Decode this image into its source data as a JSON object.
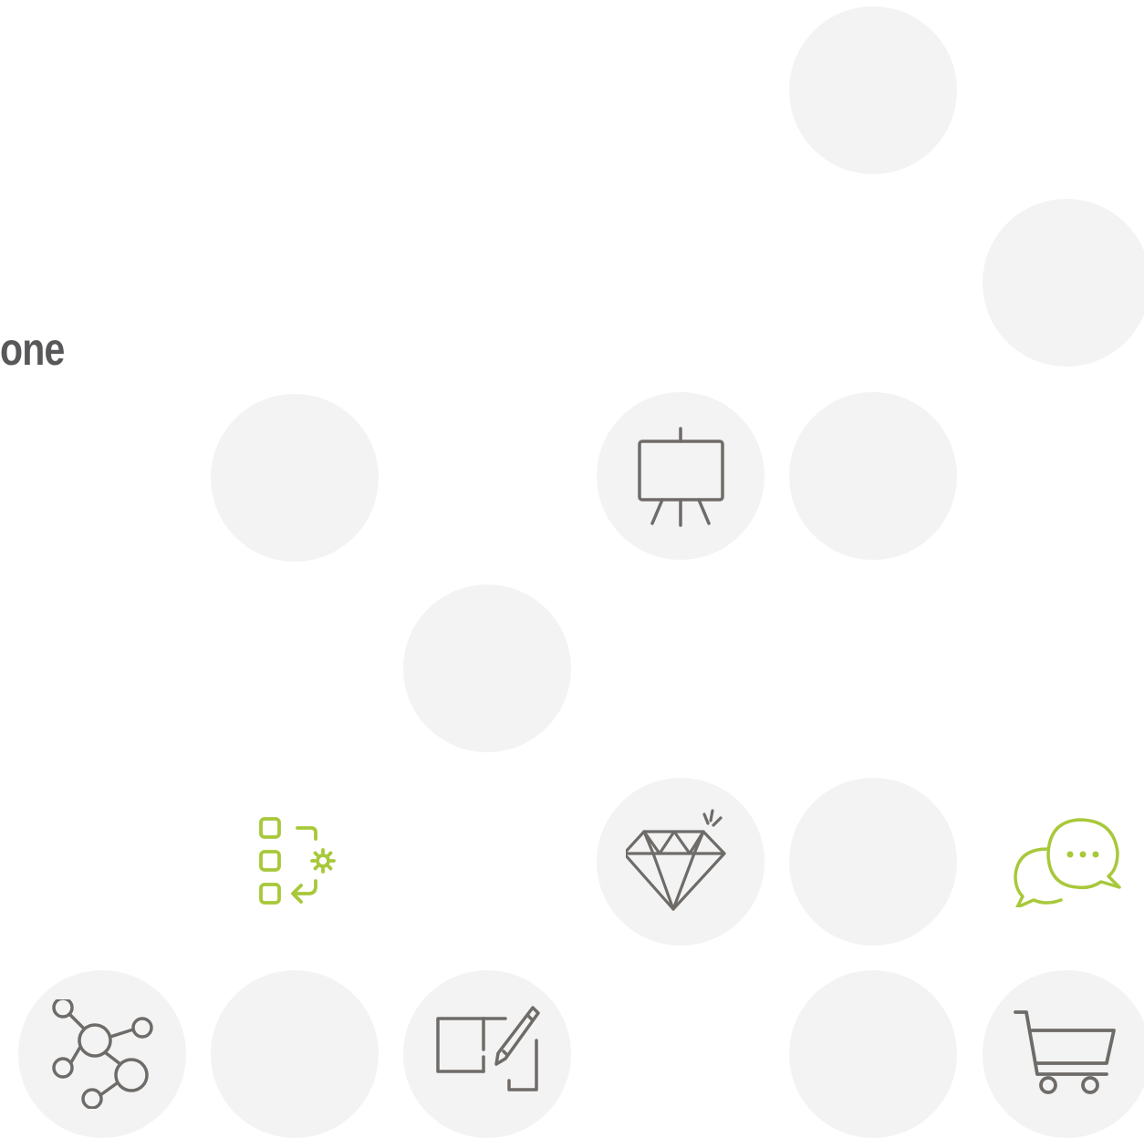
{
  "headline": "one",
  "colors": {
    "circle": "#f3f3f3",
    "icon_gray": "#6e6b68",
    "icon_green": "#a8c83a",
    "text": "#58585a"
  },
  "icons": [
    "presentation-easel-icon",
    "diamond-icon",
    "process-list-gear-icon",
    "chat-bubbles-icon",
    "network-nodes-icon",
    "wireframe-pencil-icon",
    "shopping-cart-icon"
  ]
}
